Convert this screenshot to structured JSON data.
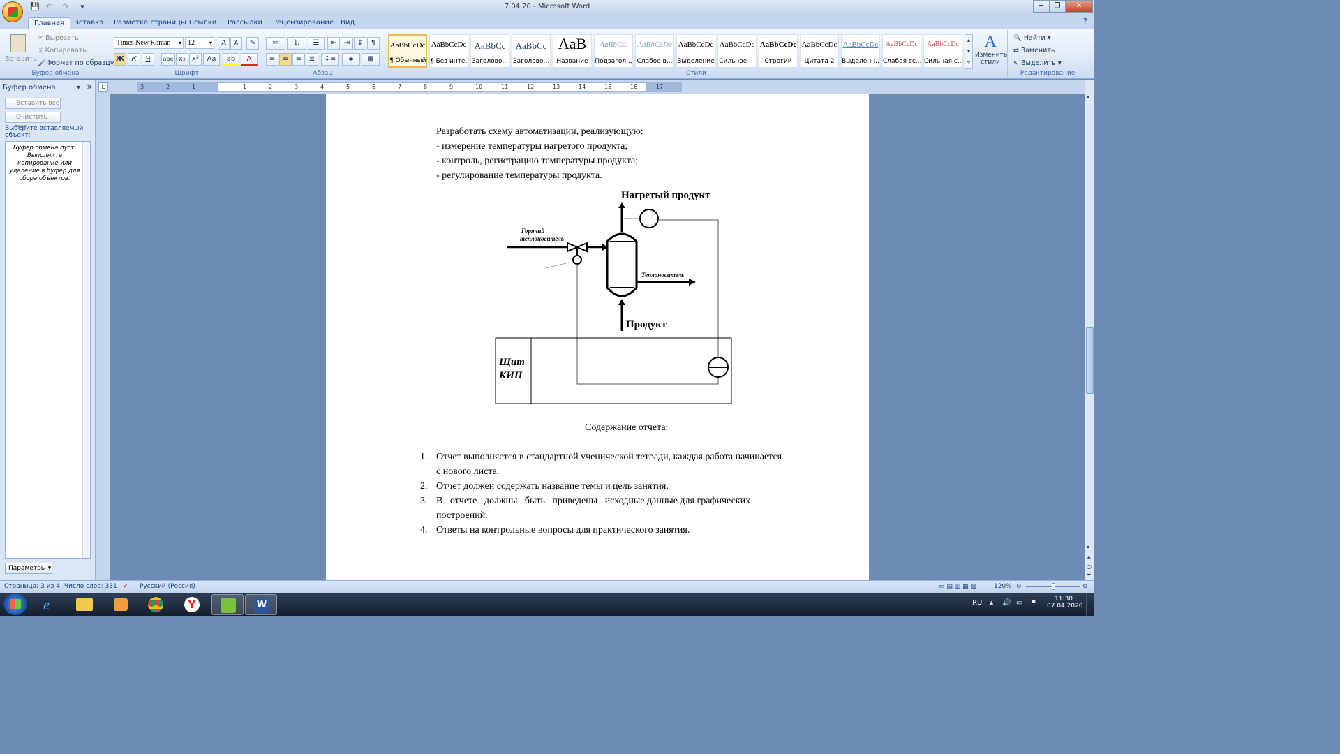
{
  "window": {
    "title": "7.04.20 - Microsoft Word"
  },
  "tabs": [
    "Главная",
    "Вставка",
    "Разметка страницы",
    "Ссылки",
    "Рассылки",
    "Рецензирование",
    "Вид"
  ],
  "clipboard_group": {
    "paste": "Вставить",
    "cut": "Вырезать",
    "copy": "Копировать",
    "format_painter": "Формат по образцу",
    "label": "Буфер обмена"
  },
  "font_group": {
    "font_name": "Times New Roman",
    "font_size": "12",
    "label": "Шрифт",
    "bold": "Ж",
    "italic": "К",
    "underline": "Ч",
    "strike": "abe",
    "sub": "x₂",
    "sup": "x²",
    "case": "Aa"
  },
  "paragraph_group": {
    "label": "Абзац"
  },
  "styles_group": {
    "label": "Стили",
    "change_styles": "Изменить стили",
    "tiles": [
      {
        "sample": "AaBbCcDc",
        "name": "¶ Обычный"
      },
      {
        "sample": "AaBbCcDc",
        "name": "¶ Без инте..."
      },
      {
        "sample": "AaBbCc",
        "name": "Заголово..."
      },
      {
        "sample": "AaBbCc",
        "name": "Заголово..."
      },
      {
        "sample": "AaB",
        "name": "Название"
      },
      {
        "sample": "AaBbCc.",
        "name": "Подзагол..."
      },
      {
        "sample": "AaBbCcDc",
        "name": "Слабое в..."
      },
      {
        "sample": "AaBbCcDc",
        "name": "Выделение"
      },
      {
        "sample": "AaBbCcDc",
        "name": "Сильное ..."
      },
      {
        "sample": "AaBbCcDc",
        "name": "Строгий"
      },
      {
        "sample": "AaBbCcDc",
        "name": "Цитата 2"
      },
      {
        "sample": "AaBbCcDc",
        "name": "Выделенн..."
      },
      {
        "sample": "AaBbCcDc",
        "name": "Слабая сс..."
      },
      {
        "sample": "AaBbCcDc",
        "name": "Сильная с..."
      }
    ]
  },
  "editing_group": {
    "find": "Найти",
    "replace": "Заменить",
    "select": "Выделить",
    "label": "Редактирование"
  },
  "ruler": {
    "numbers": [
      "3",
      "2",
      "1",
      "1",
      "2",
      "3",
      "4",
      "5",
      "6",
      "7",
      "8",
      "9",
      "10",
      "11",
      "12",
      "13",
      "14",
      "15",
      "16",
      "17"
    ]
  },
  "task_pane": {
    "title": "Буфер обмена",
    "paste_all": "Вставить все",
    "clear_all": "Очистить все",
    "prompt": "Выберите вставляемый объект:",
    "empty_message": "Буфер обмена пуст. Выполните копирование или удаление в буфер для сбора объектов.",
    "params": "Параметры"
  },
  "document": {
    "intro": "Разработать схему автоматизации, реализующую:",
    "bullets": [
      "- измерение температуры нагретого продукта;",
      "- контроль, регистрацию температуры продукта;",
      "-  регулирование температуры продукта."
    ],
    "diagram": {
      "heated_product": "Нагретый продукт",
      "hot_coolant_line1": "Горячий",
      "hot_coolant_line2": "теплоноситель",
      "coolant": "Теплоноситель",
      "product": "Продукт",
      "panel_line1": "Щит",
      "panel_line2": "КИП"
    },
    "report_heading": "Содержание отчета:",
    "report_items": [
      {
        "num": "1.",
        "line1": "Отчет выполняется в стандартной ученической тетради, каждая работа начинается",
        "line2": "с нового листа."
      },
      {
        "num": "2.",
        "line1": "Отчет должен содержать название темы и цель занятия.",
        "line2": ""
      },
      {
        "num": "3.",
        "line1": "В   отчете   должны   быть   приведены   исходные данные для графических",
        "line2": "построений."
      },
      {
        "num": "4.",
        "line1": "Ответы на контрольные вопросы для практического занятия.",
        "line2": ""
      }
    ]
  },
  "status": {
    "page": "Страница: 3 из 4",
    "words": "Число слов: 331",
    "language": "Русский (Россия)",
    "zoom": "120%"
  },
  "taskbar": {
    "lang": "RU",
    "time": "11:30",
    "date": "07.04.2020"
  }
}
